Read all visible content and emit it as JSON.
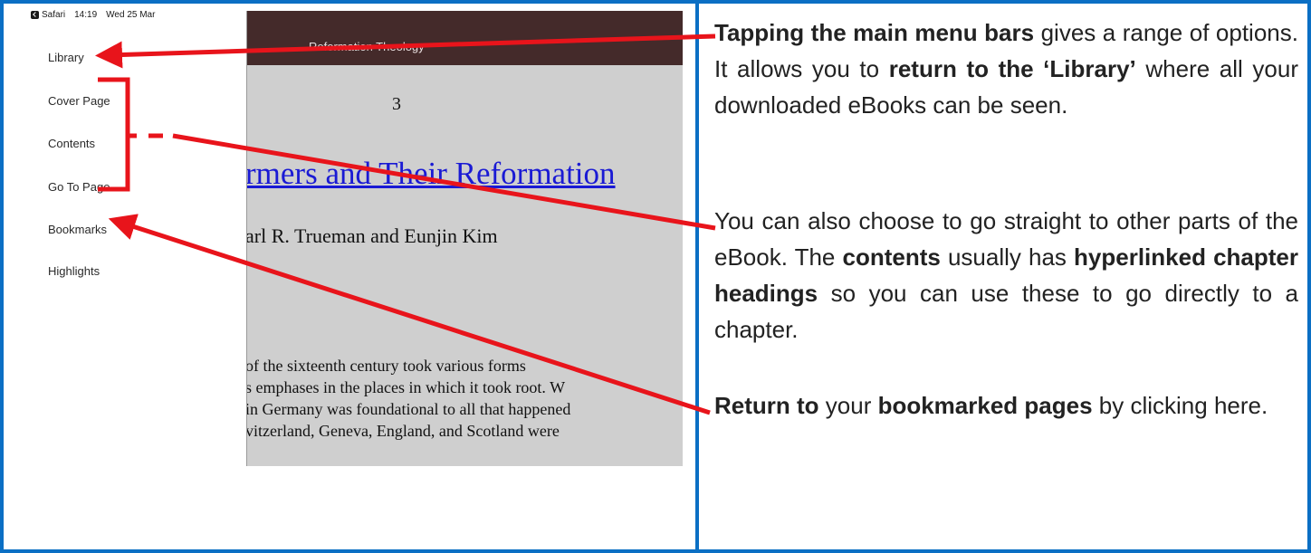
{
  "ipad": {
    "status_bar": {
      "app": "Safari",
      "time": "14:19",
      "date": "Wed 25 Mar"
    },
    "menu": [
      {
        "label": "Library"
      },
      {
        "label": "Cover Page"
      },
      {
        "label": "Contents"
      },
      {
        "label": "Go To Page"
      },
      {
        "label": "Bookmarks"
      },
      {
        "label": "Highlights"
      }
    ],
    "book": {
      "header_title": "Reformation Theology",
      "page_number": "3",
      "chapter_title": "rmers and Their Reformation",
      "authors": "arl R. Trueman and Eunjin Kim",
      "body_lines": [
        "of the sixteenth century took various forms",
        "s emphases in the places in which it took root. W",
        "in Germany was foundational to all that happened",
        "vitzerland, Geneva, England, and Scotland were"
      ]
    }
  },
  "colors": {
    "frame": "#0b6fc4",
    "arrow": "#e8141b",
    "header": "#442a2a",
    "link": "#1a1ad4"
  },
  "explanations": {
    "p1": {
      "bold1": "Tapping the main menu bars",
      "text1": " gives a range of options. It allows you to ",
      "bold2": "return to the ‘Library’",
      "text2": " where all your downloaded eBooks can be seen."
    },
    "p2": {
      "text1": "You can also choose to go straight to other parts of the eBook. The ",
      "bold1": "contents",
      "text2": " usually has ",
      "bold2": "hyperlinked chapter headings",
      "text3": " so you can use these to go directly to a chapter."
    },
    "p3": {
      "bold1": "Return to",
      "text1": " your ",
      "bold2": "bookmarked pages",
      "text2": " by clicking here."
    }
  }
}
